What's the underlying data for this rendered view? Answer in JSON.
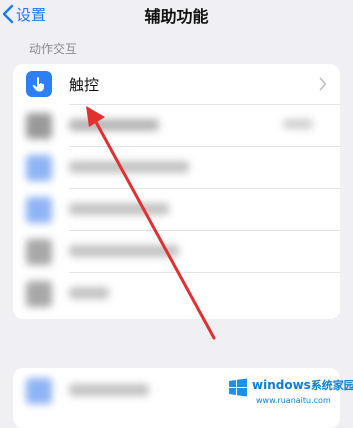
{
  "nav": {
    "back_label": "设置",
    "title": "辅助功能"
  },
  "section": {
    "header": "动作交互"
  },
  "rows": [
    {
      "label": "触控",
      "icon": "hand-touch-icon"
    }
  ],
  "watermark": {
    "brand": "windows",
    "brand_suffix": "系统家园",
    "url": "www.ruanaitu.com"
  },
  "colors": {
    "accent": "#1a7cf5",
    "icon_bg": "#2c7ff6",
    "arrow": "#e0302f",
    "background": "#efeff4"
  }
}
